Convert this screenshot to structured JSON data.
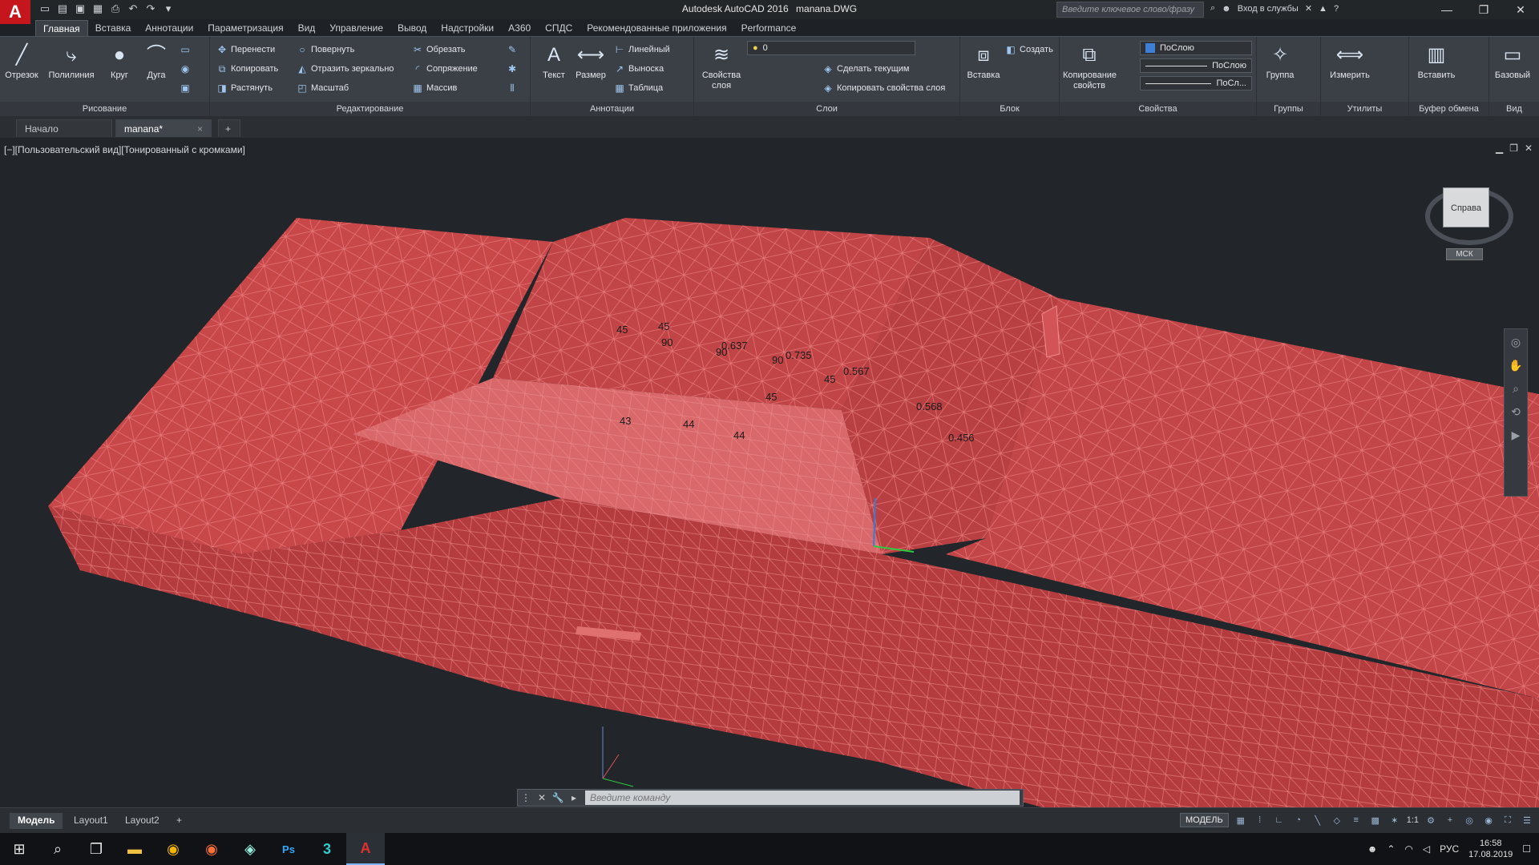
{
  "titlebar": {
    "app_name": "Autodesk AutoCAD 2016",
    "file_name": "manana.DWG",
    "search_placeholder": "Введите ключевое слово/фразу",
    "signin": "Вход в службы"
  },
  "menu_tabs": [
    "Главная",
    "Вставка",
    "Аннотации",
    "Параметризация",
    "Вид",
    "Управление",
    "Вывод",
    "Надстройки",
    "A360",
    "СПДС",
    "Рекомендованные приложения",
    "Performance"
  ],
  "ribbon": {
    "draw": {
      "title": "Рисование",
      "line": "Отрезок",
      "polyline": "Полилиния",
      "circle": "Круг",
      "arc": "Дуга"
    },
    "modify": {
      "title": "Редактирование",
      "move": "Перенести",
      "rotate": "Повернуть",
      "trim": "Обрезать",
      "copy": "Копировать",
      "mirror": "Отразить зеркально",
      "fillet": "Сопряжение",
      "stretch": "Растянуть",
      "scale": "Масштаб",
      "array": "Массив"
    },
    "annotation": {
      "title": "Аннотации",
      "text": "Текст",
      "dimension": "Размер",
      "linear": "Линейный",
      "leader": "Выноска",
      "table": "Таблица"
    },
    "layers": {
      "title": "Слои",
      "props": "Свойства слоя",
      "layer_value": "0",
      "make_current": "Сделать текущим",
      "match_layer": "Копировать свойства слоя"
    },
    "block": {
      "title": "Блок",
      "insert": "Вставка",
      "create": "Создать"
    },
    "properties": {
      "title": "Свойства",
      "match": "Копирование свойств",
      "color": "ПоСлою",
      "linetype": "ПоСлою",
      "lineweight": "ПоСл..."
    },
    "groups": {
      "title": "Группы",
      "group": "Группа"
    },
    "utilities": {
      "title": "Утилиты",
      "measure": "Измерить"
    },
    "clipboard": {
      "title": "Буфер обмена",
      "paste": "Вставить"
    },
    "view": {
      "title": "Вид",
      "base": "Базовый"
    }
  },
  "doc_tabs": {
    "start": "Начало",
    "active": "manana*"
  },
  "viewport": {
    "label": "[−][Пользовательский вид][Тонированный с кромками]",
    "viewcube_face": "Справа",
    "wcs": "МСК",
    "dimensions": [
      "45",
      "45",
      "90",
      "90",
      "0.637",
      "90",
      "0.735",
      "45",
      "0.567",
      "45",
      "0.568",
      "0.456",
      "43",
      "44",
      "44"
    ]
  },
  "command_line": {
    "placeholder": "Введите команду"
  },
  "layout_tabs": [
    "Модель",
    "Layout1",
    "Layout2"
  ],
  "status": {
    "model": "МОДЕЛЬ",
    "scale": "1:1"
  },
  "taskbar": {
    "lang": "РУС",
    "time": "16:58",
    "date": "17.08.2019"
  },
  "colors": {
    "car_body": "#c8494a",
    "wire": "#f07a7c",
    "accent": "#c4161c"
  }
}
